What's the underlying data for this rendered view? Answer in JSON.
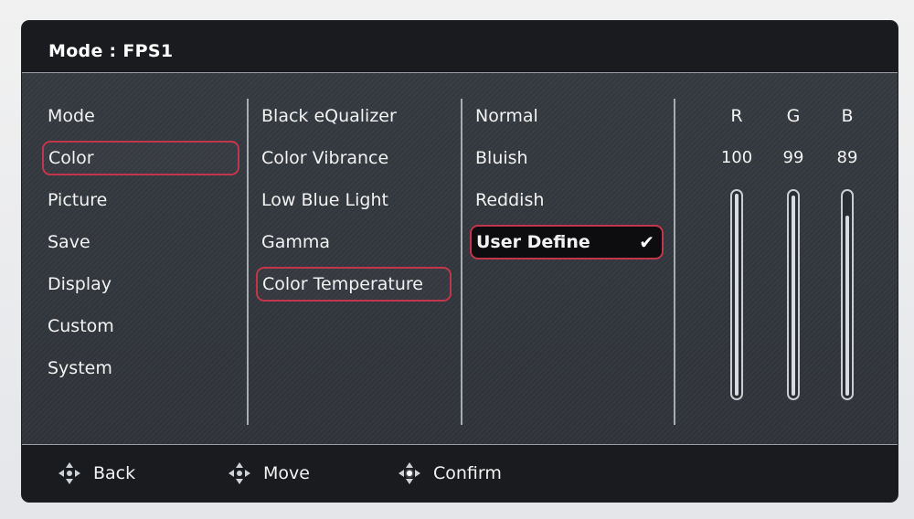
{
  "header": {
    "title": "Mode : FPS1"
  },
  "main_menu": {
    "items": [
      "Mode",
      "Color",
      "Picture",
      "Save",
      "Display",
      "Custom",
      "System"
    ],
    "selected": "Color"
  },
  "sub_menu": {
    "items": [
      "Black eQualizer",
      "Color Vibrance",
      "Low Blue Light",
      "Gamma",
      "Color Temperature"
    ],
    "selected": "Color Temperature"
  },
  "options_menu": {
    "items": [
      "Normal",
      "Bluish",
      "Reddish",
      "User Define"
    ],
    "active": "User Define",
    "check_glyph": "✔"
  },
  "rgb": {
    "labels": [
      "R",
      "G",
      "B"
    ],
    "values": [
      "100",
      "99",
      "89"
    ],
    "levels_percent": [
      100,
      99,
      89
    ]
  },
  "footer": {
    "back": "Back",
    "move": "Move",
    "confirm": "Confirm"
  },
  "colors": {
    "accent": "#c2364c",
    "panel": "#2f3338",
    "bar": "#1a1b1e"
  },
  "icons": [
    "dpad-back-icon",
    "dpad-move-icon",
    "dpad-confirm-icon",
    "checkmark-icon"
  ]
}
